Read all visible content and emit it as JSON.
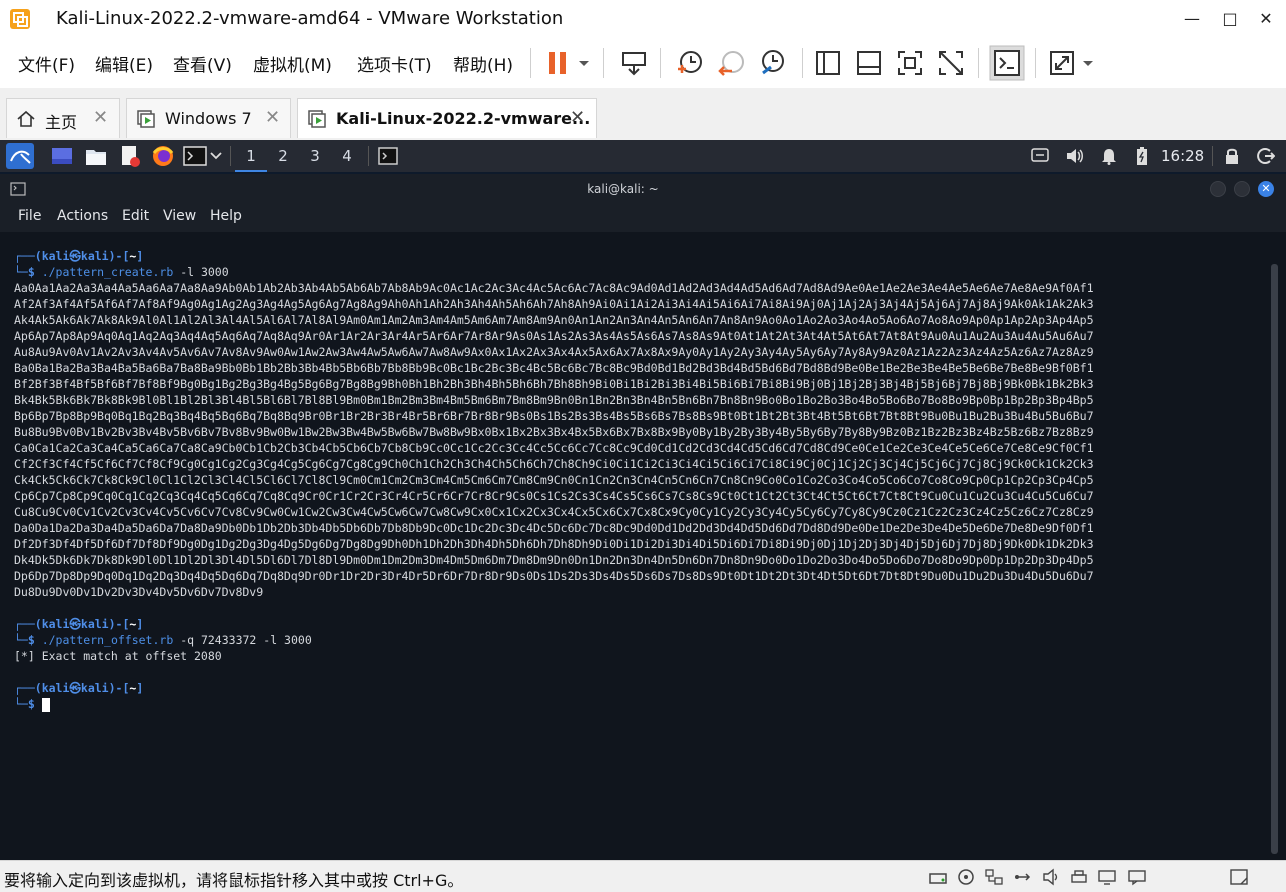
{
  "window": {
    "title": "Kali-Linux-2022.2-vmware-amd64 - VMware Workstation",
    "minimize_icon": "minimize-icon",
    "maximize_icon": "maximize-icon",
    "close_icon": "close-icon"
  },
  "menu": {
    "items": [
      "文件(F)",
      "编辑(E)",
      "查看(V)",
      "虚拟机(M)",
      "选项卡(T)",
      "帮助(H)"
    ]
  },
  "toolbar": {
    "icons": [
      "pause-icon",
      "dropdown-icon",
      "send-keys-icon",
      "snapshot-icon",
      "revert-snapshot-icon",
      "snapshot-manager-icon",
      "library-icon",
      "thumbnail-icon",
      "fullscreen-icon",
      "unity-icon",
      "console-view-icon",
      "stretch-icon",
      "dropdown-icon"
    ],
    "accent": "#e8622a"
  },
  "tabs": [
    {
      "label": "主页",
      "icon": "home-icon",
      "active": false
    },
    {
      "label": "Windows 7",
      "icon": "vm-icon",
      "active": false
    },
    {
      "label": "Kali-Linux-2022.2-vmware...",
      "icon": "vm-icon",
      "active": true
    }
  ],
  "kali_panel": {
    "workspaces": [
      "1",
      "2",
      "3",
      "4"
    ],
    "active_workspace": "1",
    "time": "16:28",
    "apps": [
      "kali-menu-icon",
      "desktop-icon",
      "file-manager-icon",
      "text-editor-icon",
      "firefox-icon",
      "terminal-icon"
    ]
  },
  "terminal": {
    "title": "kali@kali: ~",
    "menu": [
      "File",
      "Actions",
      "Edit",
      "View",
      "Help"
    ],
    "prompt_user": "kali",
    "prompt_host": "kali",
    "prompt_dir": "~",
    "commands": [
      {
        "cmd": "./pattern_create.rb",
        "args": " -l 3000"
      },
      {
        "cmd": "./pattern_offset.rb",
        "args": " -q 72433372 -l 3000"
      }
    ],
    "pattern_lines": [
      "Aa0Aa1Aa2Aa3Aa4Aa5Aa6Aa7Aa8Aa9Ab0Ab1Ab2Ab3Ab4Ab5Ab6Ab7Ab8Ab9Ac0Ac1Ac2Ac3Ac4Ac5Ac6Ac7Ac8Ac9Ad0Ad1Ad2Ad3Ad4Ad5Ad6Ad7Ad8Ad9Ae0Ae1Ae2Ae3Ae4Ae5Ae6Ae7Ae8Ae9Af0Af1",
      "Af2Af3Af4Af5Af6Af7Af8Af9Ag0Ag1Ag2Ag3Ag4Ag5Ag6Ag7Ag8Ag9Ah0Ah1Ah2Ah3Ah4Ah5Ah6Ah7Ah8Ah9Ai0Ai1Ai2Ai3Ai4Ai5Ai6Ai7Ai8Ai9Aj0Aj1Aj2Aj3Aj4Aj5Aj6Aj7Aj8Aj9Ak0Ak1Ak2Ak3",
      "Ak4Ak5Ak6Ak7Ak8Ak9Al0Al1Al2Al3Al4Al5Al6Al7Al8Al9Am0Am1Am2Am3Am4Am5Am6Am7Am8Am9An0An1An2An3An4An5An6An7An8An9Ao0Ao1Ao2Ao3Ao4Ao5Ao6Ao7Ao8Ao9Ap0Ap1Ap2Ap3Ap4Ap5",
      "Ap6Ap7Ap8Ap9Aq0Aq1Aq2Aq3Aq4Aq5Aq6Aq7Aq8Aq9Ar0Ar1Ar2Ar3Ar4Ar5Ar6Ar7Ar8Ar9As0As1As2As3As4As5As6As7As8As9At0At1At2At3At4At5At6At7At8At9Au0Au1Au2Au3Au4Au5Au6Au7",
      "Au8Au9Av0Av1Av2Av3Av4Av5Av6Av7Av8Av9Aw0Aw1Aw2Aw3Aw4Aw5Aw6Aw7Aw8Aw9Ax0Ax1Ax2Ax3Ax4Ax5Ax6Ax7Ax8Ax9Ay0Ay1Ay2Ay3Ay4Ay5Ay6Ay7Ay8Ay9Az0Az1Az2Az3Az4Az5Az6Az7Az8Az9",
      "Ba0Ba1Ba2Ba3Ba4Ba5Ba6Ba7Ba8Ba9Bb0Bb1Bb2Bb3Bb4Bb5Bb6Bb7Bb8Bb9Bc0Bc1Bc2Bc3Bc4Bc5Bc6Bc7Bc8Bc9Bd0Bd1Bd2Bd3Bd4Bd5Bd6Bd7Bd8Bd9Be0Be1Be2Be3Be4Be5Be6Be7Be8Be9Bf0Bf1",
      "Bf2Bf3Bf4Bf5Bf6Bf7Bf8Bf9Bg0Bg1Bg2Bg3Bg4Bg5Bg6Bg7Bg8Bg9Bh0Bh1Bh2Bh3Bh4Bh5Bh6Bh7Bh8Bh9Bi0Bi1Bi2Bi3Bi4Bi5Bi6Bi7Bi8Bi9Bj0Bj1Bj2Bj3Bj4Bj5Bj6Bj7Bj8Bj9Bk0Bk1Bk2Bk3",
      "Bk4Bk5Bk6Bk7Bk8Bk9Bl0Bl1Bl2Bl3Bl4Bl5Bl6Bl7Bl8Bl9Bm0Bm1Bm2Bm3Bm4Bm5Bm6Bm7Bm8Bm9Bn0Bn1Bn2Bn3Bn4Bn5Bn6Bn7Bn8Bn9Bo0Bo1Bo2Bo3Bo4Bo5Bo6Bo7Bo8Bo9Bp0Bp1Bp2Bp3Bp4Bp5",
      "Bp6Bp7Bp8Bp9Bq0Bq1Bq2Bq3Bq4Bq5Bq6Bq7Bq8Bq9Br0Br1Br2Br3Br4Br5Br6Br7Br8Br9Bs0Bs1Bs2Bs3Bs4Bs5Bs6Bs7Bs8Bs9Bt0Bt1Bt2Bt3Bt4Bt5Bt6Bt7Bt8Bt9Bu0Bu1Bu2Bu3Bu4Bu5Bu6Bu7",
      "Bu8Bu9Bv0Bv1Bv2Bv3Bv4Bv5Bv6Bv7Bv8Bv9Bw0Bw1Bw2Bw3Bw4Bw5Bw6Bw7Bw8Bw9Bx0Bx1Bx2Bx3Bx4Bx5Bx6Bx7Bx8Bx9By0By1By2By3By4By5By6By7By8By9Bz0Bz1Bz2Bz3Bz4Bz5Bz6Bz7Bz8Bz9",
      "Ca0Ca1Ca2Ca3Ca4Ca5Ca6Ca7Ca8Ca9Cb0Cb1Cb2Cb3Cb4Cb5Cb6Cb7Cb8Cb9Cc0Cc1Cc2Cc3Cc4Cc5Cc6Cc7Cc8Cc9Cd0Cd1Cd2Cd3Cd4Cd5Cd6Cd7Cd8Cd9Ce0Ce1Ce2Ce3Ce4Ce5Ce6Ce7Ce8Ce9Cf0Cf1",
      "Cf2Cf3Cf4Cf5Cf6Cf7Cf8Cf9Cg0Cg1Cg2Cg3Cg4Cg5Cg6Cg7Cg8Cg9Ch0Ch1Ch2Ch3Ch4Ch5Ch6Ch7Ch8Ch9Ci0Ci1Ci2Ci3Ci4Ci5Ci6Ci7Ci8Ci9Cj0Cj1Cj2Cj3Cj4Cj5Cj6Cj7Cj8Cj9Ck0Ck1Ck2Ck3",
      "Ck4Ck5Ck6Ck7Ck8Ck9Cl0Cl1Cl2Cl3Cl4Cl5Cl6Cl7Cl8Cl9Cm0Cm1Cm2Cm3Cm4Cm5Cm6Cm7Cm8Cm9Cn0Cn1Cn2Cn3Cn4Cn5Cn6Cn7Cn8Cn9Co0Co1Co2Co3Co4Co5Co6Co7Co8Co9Cp0Cp1Cp2Cp3Cp4Cp5",
      "Cp6Cp7Cp8Cp9Cq0Cq1Cq2Cq3Cq4Cq5Cq6Cq7Cq8Cq9Cr0Cr1Cr2Cr3Cr4Cr5Cr6Cr7Cr8Cr9Cs0Cs1Cs2Cs3Cs4Cs5Cs6Cs7Cs8Cs9Ct0Ct1Ct2Ct3Ct4Ct5Ct6Ct7Ct8Ct9Cu0Cu1Cu2Cu3Cu4Cu5Cu6Cu7",
      "Cu8Cu9Cv0Cv1Cv2Cv3Cv4Cv5Cv6Cv7Cv8Cv9Cw0Cw1Cw2Cw3Cw4Cw5Cw6Cw7Cw8Cw9Cx0Cx1Cx2Cx3Cx4Cx5Cx6Cx7Cx8Cx9Cy0Cy1Cy2Cy3Cy4Cy5Cy6Cy7Cy8Cy9Cz0Cz1Cz2Cz3Cz4Cz5Cz6Cz7Cz8Cz9",
      "Da0Da1Da2Da3Da4Da5Da6Da7Da8Da9Db0Db1Db2Db3Db4Db5Db6Db7Db8Db9Dc0Dc1Dc2Dc3Dc4Dc5Dc6Dc7Dc8Dc9Dd0Dd1Dd2Dd3Dd4Dd5Dd6Dd7Dd8Dd9De0De1De2De3De4De5De6De7De8De9Df0Df1",
      "Df2Df3Df4Df5Df6Df7Df8Df9Dg0Dg1Dg2Dg3Dg4Dg5Dg6Dg7Dg8Dg9Dh0Dh1Dh2Dh3Dh4Dh5Dh6Dh7Dh8Dh9Di0Di1Di2Di3Di4Di5Di6Di7Di8Di9Dj0Dj1Dj2Dj3Dj4Dj5Dj6Dj7Dj8Dj9Dk0Dk1Dk2Dk3",
      "Dk4Dk5Dk6Dk7Dk8Dk9Dl0Dl1Dl2Dl3Dl4Dl5Dl6Dl7Dl8Dl9Dm0Dm1Dm2Dm3Dm4Dm5Dm6Dm7Dm8Dm9Dn0Dn1Dn2Dn3Dn4Dn5Dn6Dn7Dn8Dn9Do0Do1Do2Do3Do4Do5Do6Do7Do8Do9Dp0Dp1Dp2Dp3Dp4Dp5",
      "Dp6Dp7Dp8Dp9Dq0Dq1Dq2Dq3Dq4Dq5Dq6Dq7Dq8Dq9Dr0Dr1Dr2Dr3Dr4Dr5Dr6Dr7Dr8Dr9Ds0Ds1Ds2Ds3Ds4Ds5Ds6Ds7Ds8Ds9Dt0Dt1Dt2Dt3Dt4Dt5Dt6Dt7Dt8Dt9Du0Du1Du2Du3Du4Du5Du6Du7",
      "Du8Du9Dv0Dv1Dv2Dv3Dv4Dv5Dv6Dv7Dv8Dv9"
    ],
    "offset_result": "[*] Exact match at offset 2080"
  },
  "statusbar": {
    "text": "要将输入定向到该虚拟机，请将鼠标指针移入其中或按 Ctrl+G。",
    "icons": [
      "hdd-icon",
      "cd-icon",
      "network-icon",
      "usb-icon",
      "sound-icon",
      "printer-icon",
      "display-icon",
      "message-icon",
      "expand-icon"
    ]
  }
}
